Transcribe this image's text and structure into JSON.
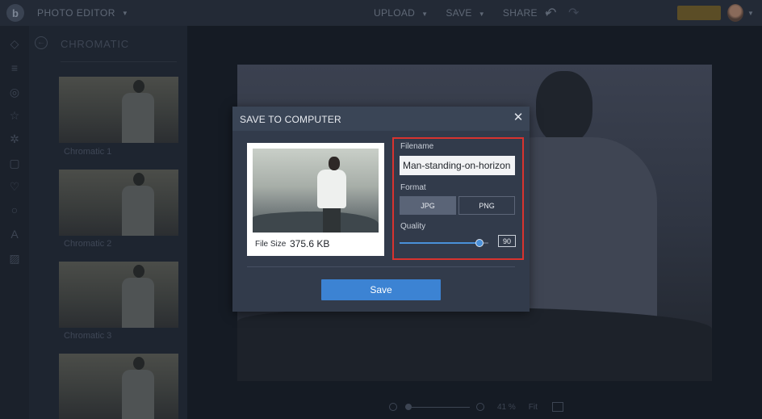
{
  "topbar": {
    "logo_letter": "b",
    "app_menu": "PHOTO EDITOR",
    "actions": [
      "UPLOAD",
      "SAVE",
      "SHARE"
    ],
    "upgrade_label": "",
    "icons": [
      "undo-icon",
      "redo-icon"
    ]
  },
  "panel": {
    "title": "CHROMATIC",
    "items": [
      {
        "label": "Chromatic 1"
      },
      {
        "label": "Chromatic 2"
      },
      {
        "label": "Chromatic 3"
      },
      {
        "label": ""
      }
    ]
  },
  "canvas": {
    "zoom_percent": "41 %",
    "fit_label": "Fit"
  },
  "dialog": {
    "title": "SAVE TO COMPUTER",
    "close_glyph": "✕",
    "file_size_label": "File Size",
    "file_size_value": "375.6 KB",
    "filename_label": "Filename",
    "filename_value": "Man-standing-on-horizon",
    "format_label": "Format",
    "format_options": [
      "JPG",
      "PNG"
    ],
    "format_selected": "JPG",
    "quality_label": "Quality",
    "quality_value": 90,
    "quality_display": "90",
    "save_label": "Save"
  },
  "colors": {
    "accent": "#3c83d3",
    "highlight_border": "#d8332f",
    "dialog_bg": "#323b4b"
  }
}
